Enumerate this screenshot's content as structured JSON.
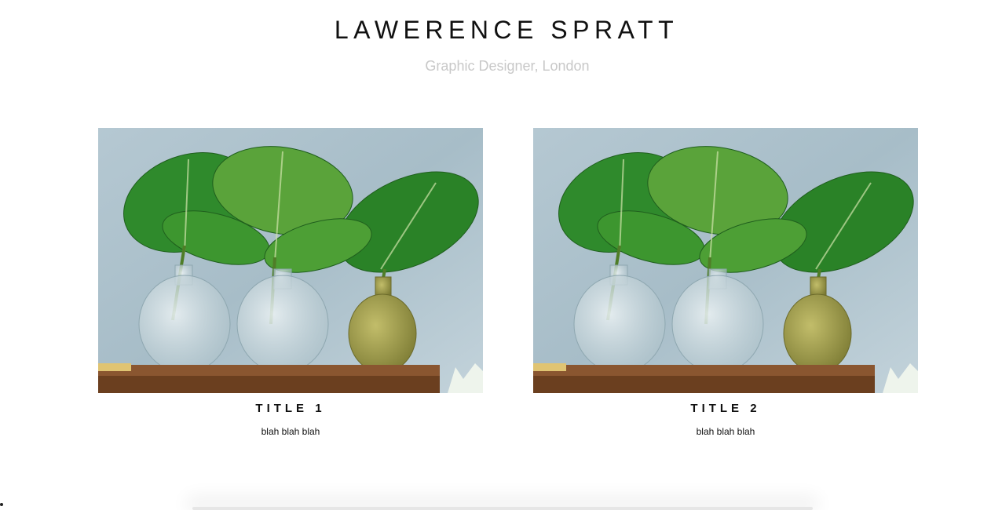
{
  "header": {
    "title": "LAWERENCE SPRATT",
    "subtitle": "Graphic Designer, London"
  },
  "projects": [
    {
      "title": "TITLE 1",
      "description": "blah blah blah",
      "image": "monstera-leaves-in-glass-jars"
    },
    {
      "title": "TITLE 2",
      "description": "blah blah blah",
      "image": "monstera-leaves-in-glass-jars"
    }
  ],
  "colors": {
    "title": "#111111",
    "subtitle": "#c8c8c8",
    "background": "#ffffff",
    "wall": "#a9c0cb",
    "shelf": "#7a4b2a",
    "leaf": "#2f8a2c"
  }
}
